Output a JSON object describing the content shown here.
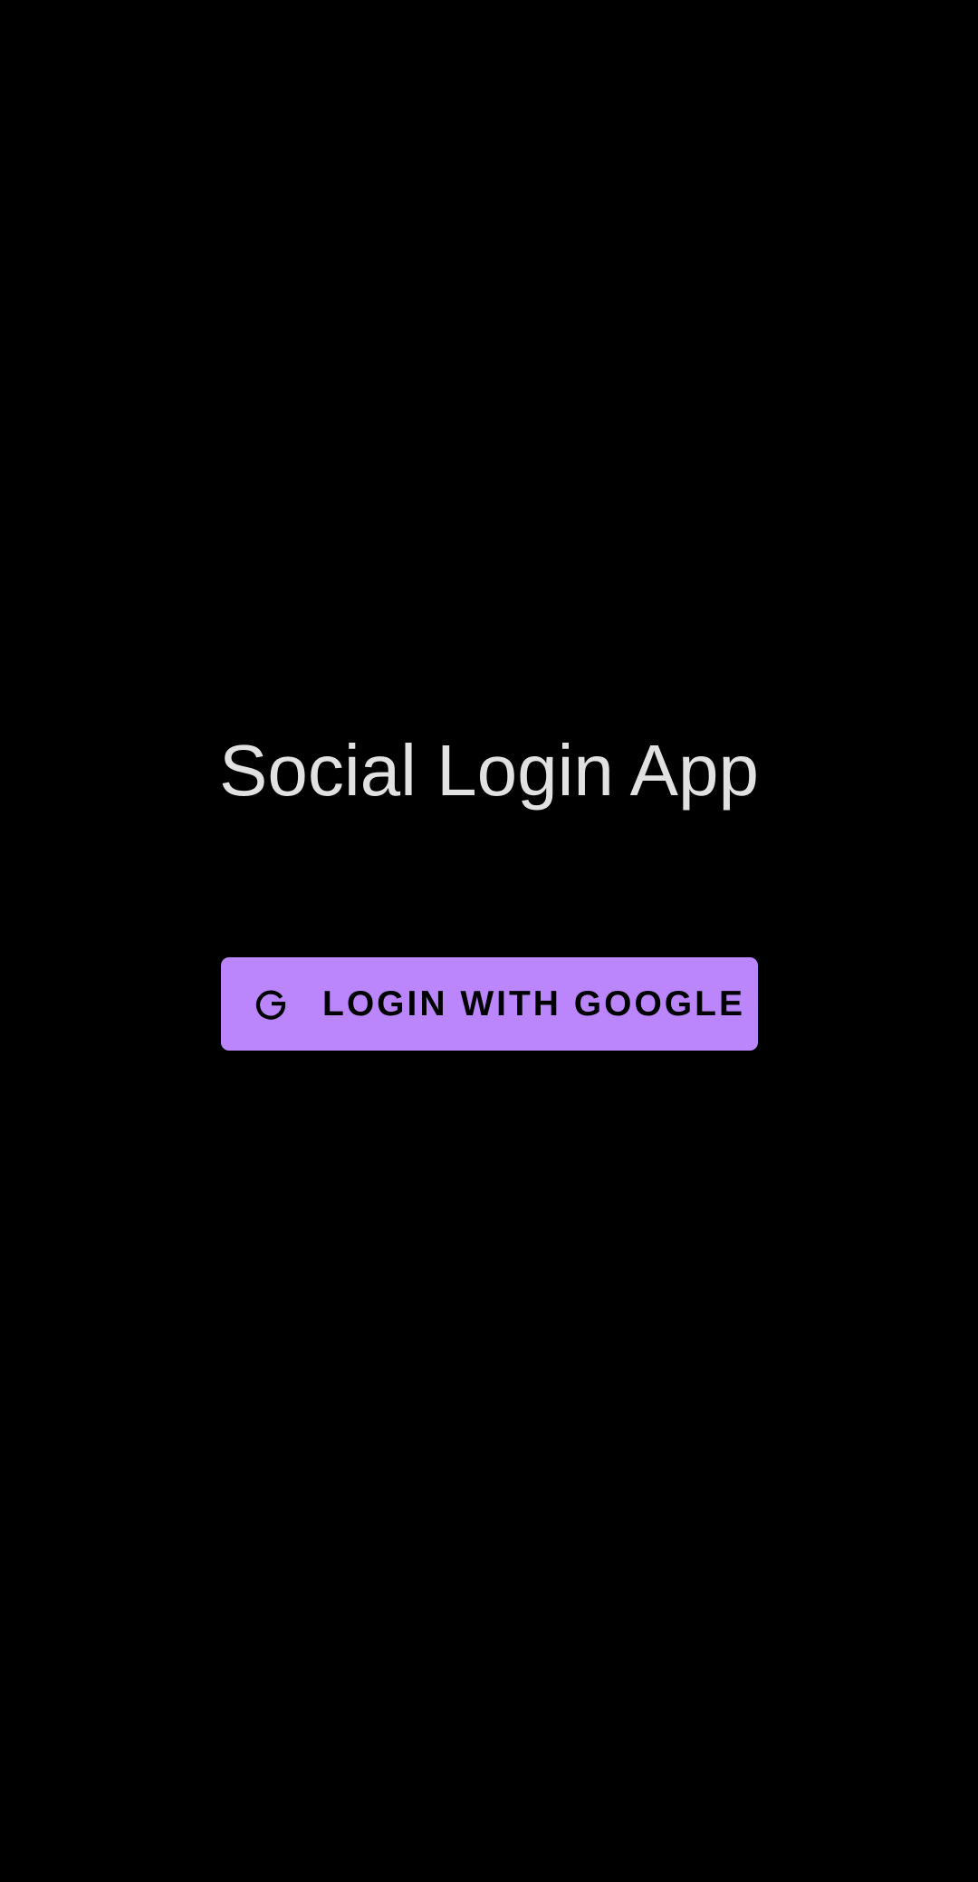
{
  "app": {
    "title": "Social Login App"
  },
  "login_button": {
    "label": "LOGIN WITH GOOGLE",
    "icon": "google-g-icon"
  },
  "colors": {
    "background": "#000000",
    "title_text": "#e1e1e1",
    "button_background": "#bb86fc",
    "button_text": "#000000"
  }
}
